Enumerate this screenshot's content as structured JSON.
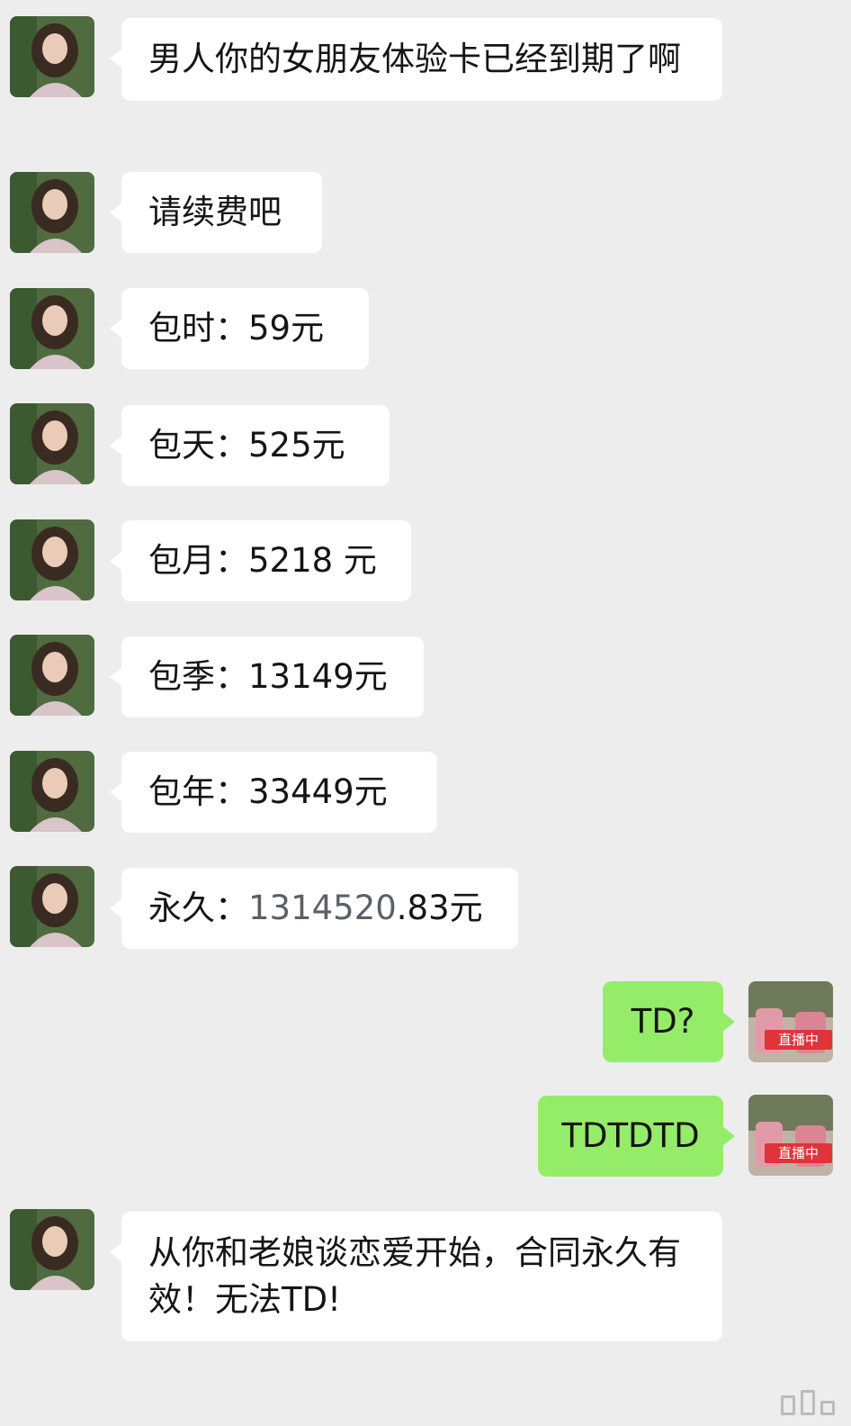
{
  "messages": [
    {
      "side": "in",
      "text": "男人你的女朋友体验卡已经到期了啊"
    },
    {
      "side": "in",
      "text": "请续费吧"
    },
    {
      "side": "in",
      "text": "包时：59元"
    },
    {
      "side": "in",
      "text": "包天：525元"
    },
    {
      "side": "in",
      "text": "包月：5218 元"
    },
    {
      "side": "in",
      "text": "包季：13149元"
    },
    {
      "side": "in",
      "text": "包年：33449元"
    },
    {
      "side": "in",
      "label": "永久：",
      "grey": "1314520",
      "rest": ".83元"
    },
    {
      "side": "out",
      "text": "TD?",
      "live_tag": "直播中"
    },
    {
      "side": "out",
      "text": "TDTDTD",
      "live_tag": "直播中"
    },
    {
      "side": "in",
      "text": "从你和老娘谈恋爱开始，合同永久有效！无法TD!"
    }
  ],
  "colors": {
    "background": "#ededed",
    "incoming": "#ffffff",
    "outgoing": "#95ec69",
    "live_tag": "#e0333a"
  },
  "icons": {
    "avatar_in": "woman-portrait-avatar",
    "avatar_out": "livestream-avatar"
  }
}
